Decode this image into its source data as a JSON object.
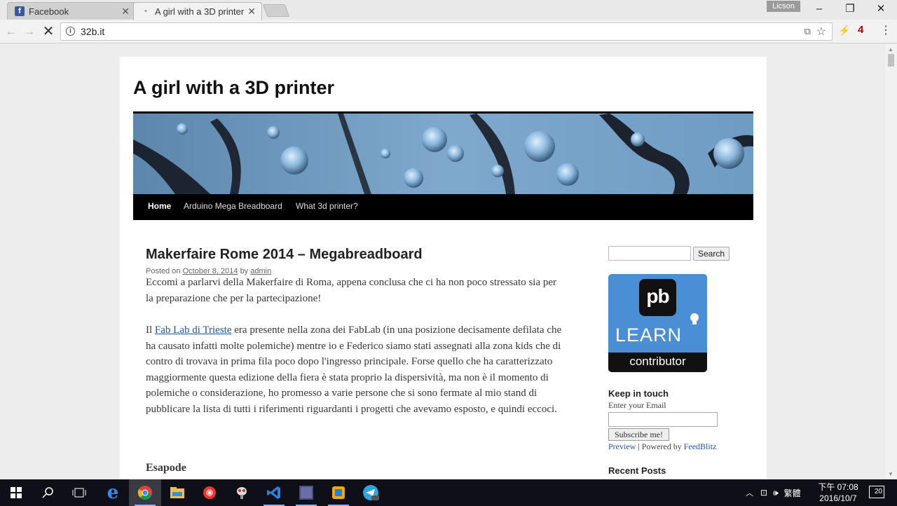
{
  "tabs": [
    {
      "title": "Facebook",
      "active": false
    },
    {
      "title": "A girl with a 3D printer",
      "active": true
    }
  ],
  "profile_name": "Licson",
  "window_controls": {
    "minimize": "–",
    "restore": "❐",
    "close": "✕"
  },
  "toolbar": {
    "url": "32b.it",
    "extension_badge": "4"
  },
  "site": {
    "title": "A girl with a 3D printer",
    "nav": [
      "Home",
      "Arduino Mega Breadboard",
      "What 3d printer?"
    ]
  },
  "post": {
    "title": "Makerfaire Rome 2014 – Megabreadboard",
    "meta": {
      "posted_on": "Posted on",
      "date": "October 8, 2014",
      "by": "by",
      "author": "admin"
    },
    "paragraph1": "Eccomi a parlarvi della Makerfaire di Roma, appena conclusa che ci ha non poco stressato sia per la preparazione che per la partecipazione!",
    "paragraph2_prefix": "Il ",
    "paragraph2_link": "Fab Lab di Trieste",
    "paragraph2_rest": " era presente nella zona dei FabLab (in una posizione decisamente defilata che ha causato infatti molte polemiche) mentre io e Federico siamo stati assegnati alla zona kids che di contro di trovava in prima fila poco dopo l'ingresso principale. Forse quello che ha caratterizzato maggiormente questa edizione della fiera è stata proprio la dispersività, ma non è il momento di polemiche o considerazione, ho promesso a varie persone che si sono fermate al mio stand di pubblicare la lista di tutti i riferimenti riguardanti i progetti che avevamo esposto, e quindi eccoci.",
    "subheading": "Esapode"
  },
  "sidebar": {
    "search_button": "Search",
    "badge": {
      "logo": "pb",
      "learn": "LEARN",
      "contributor": "contributor"
    },
    "keep_in_touch": "Keep in touch",
    "email_label": "Enter your Email",
    "subscribe_button": "Subscribe me!",
    "preview_link": "Preview",
    "powered_text": " | Powered by ",
    "feedblitz_link": "FeedBlitz",
    "recent_posts": "Recent Posts"
  },
  "taskbar": {
    "ime": "繁體",
    "time": "下午 07:08",
    "date": "2016/10/7",
    "notifications": "20"
  },
  "colors": {
    "link": "#1b57b1",
    "nav_bg": "#000000",
    "page_bg": "#ededed",
    "badge_bg": "#4a8fd6"
  }
}
